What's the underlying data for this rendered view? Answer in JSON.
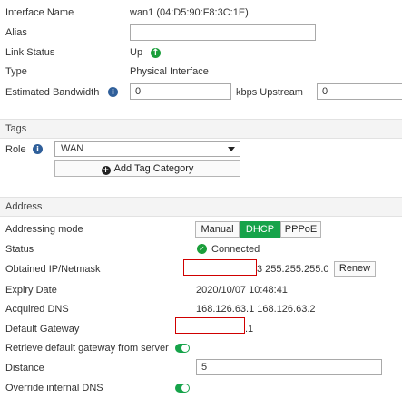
{
  "interface": {
    "name_label": "Interface Name",
    "name_value": "wan1 (04:D5:90:F8:3C:1E)",
    "alias_label": "Alias",
    "alias_value": "",
    "link_status_label": "Link Status",
    "link_status_value": "Up",
    "type_label": "Type",
    "type_value": "Physical Interface",
    "bandwidth_label": "Estimated Bandwidth",
    "bandwidth_up_value": "0",
    "bandwidth_unit": "kbps Upstream",
    "bandwidth_down_value": "0"
  },
  "tags": {
    "section_title": "Tags",
    "role_label": "Role",
    "role_value": "WAN",
    "add_category_label": "Add Tag Category"
  },
  "address": {
    "section_title": "Address",
    "mode_label": "Addressing mode",
    "modes": [
      "Manual",
      "DHCP",
      "PPPoE"
    ],
    "active_mode": "DHCP",
    "status_label": "Status",
    "status_value": "Connected",
    "ip_label": "Obtained IP/Netmask",
    "ip_value_visible": "3 255.255.255.0",
    "renew_label": "Renew",
    "expiry_label": "Expiry Date",
    "expiry_value": "2020/10/07 10:48:41",
    "dns_label": "Acquired DNS",
    "dns_value": "168.126.63.1  168.126.63.2",
    "gateway_label": "Default Gateway",
    "gateway_value_visible": ".1",
    "retrieve_gw_label": "Retrieve default gateway from server",
    "retrieve_gw_enabled": true,
    "distance_label": "Distance",
    "distance_value": "5",
    "override_dns_label": "Override internal DNS",
    "override_dns_enabled": true
  },
  "colors": {
    "accent_green": "#16a34a",
    "info_blue": "#2f5f9a",
    "redaction": "#d00000"
  }
}
